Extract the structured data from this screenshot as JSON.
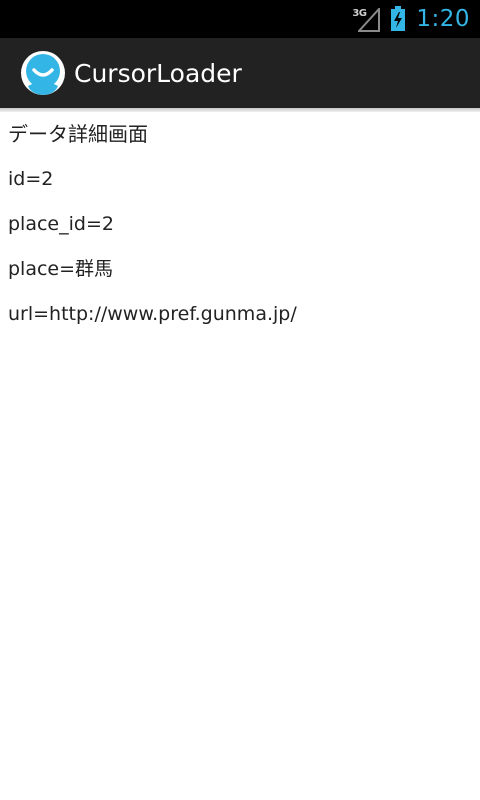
{
  "status_bar": {
    "network_type": "3G",
    "time": "1:20",
    "icons": [
      "signal-icon",
      "battery-charging-icon"
    ],
    "colors": {
      "clock": "#33b5e5"
    }
  },
  "action_bar": {
    "title": "CursorLoader",
    "icon": "app-face-icon",
    "colors": {
      "background": "#222222",
      "icon": "#33b5e5"
    }
  },
  "detail": {
    "heading": "データ詳細画面",
    "id": "id=2",
    "place_id": "place_id=2",
    "place": "place=群馬",
    "url": "url=http://www.pref.gunma.jp/"
  }
}
